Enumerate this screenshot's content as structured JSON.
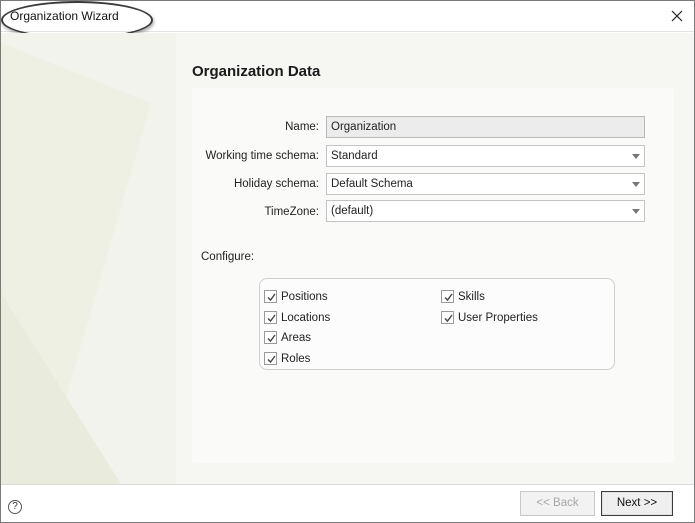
{
  "window": {
    "title": "Organization Wizard"
  },
  "page": {
    "heading": "Organization Data"
  },
  "form": {
    "name_label": "Name:",
    "name_value": "Organization",
    "working_time_label": "Working time schema:",
    "working_time_value": "Standard",
    "holiday_label": "Holiday schema:",
    "holiday_value": "Default Schema",
    "timezone_label": "TimeZone:",
    "timezone_value": "(default)"
  },
  "configure": {
    "label": "Configure:",
    "options": [
      {
        "label": "Positions",
        "checked": true
      },
      {
        "label": "Locations",
        "checked": true
      },
      {
        "label": "Areas",
        "checked": true
      },
      {
        "label": "Roles",
        "checked": true
      },
      {
        "label": "Skills",
        "checked": true
      },
      {
        "label": "User Properties",
        "checked": true
      }
    ]
  },
  "footer": {
    "help_symbol": "?",
    "back_label": "<< Back",
    "back_enabled": false,
    "next_label": "Next >>"
  },
  "icons": {
    "close": "close-icon",
    "help": "help-icon",
    "check": "check-icon",
    "dropdown": "chevron-down-icon"
  },
  "colors": {
    "content_background": "#f6f6f3",
    "decorative_shape": "#eef0e4"
  }
}
